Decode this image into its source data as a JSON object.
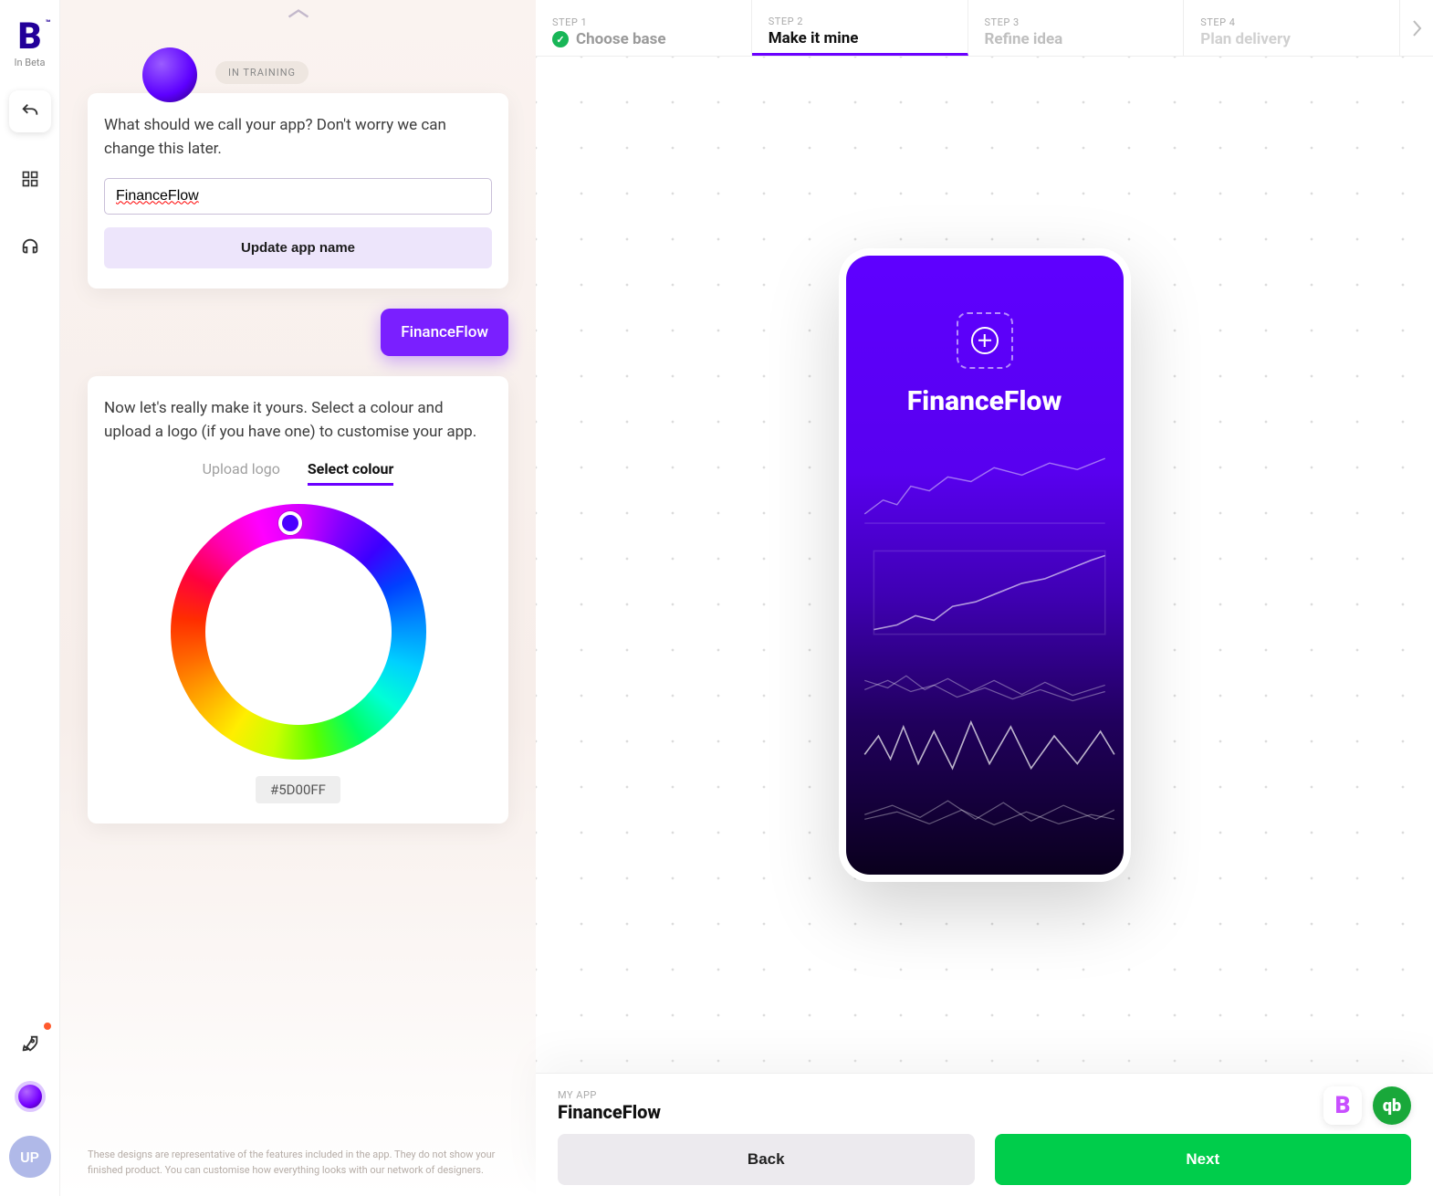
{
  "brand": {
    "mark": "B",
    "tm": "™",
    "sub": "In Beta"
  },
  "rail": {
    "avatar_initials": "UP"
  },
  "training_badge": "IN TRAINING",
  "name_card": {
    "prompt": "What should we call your app? Don't worry we can change this later.",
    "value": "FinanceFlow",
    "update_btn": "Update app name"
  },
  "user_reply": "FinanceFlow",
  "colour_card": {
    "prompt": "Now let's really make it yours. Select a colour and upload a logo (if you have one) to customise your app.",
    "tab_upload": "Upload logo",
    "tab_colour": "Select colour",
    "hex": "#5D00FF"
  },
  "note": "These designs are representative of the features included in the app. They do not show your finished product. You can customise how everything looks with our network of designers.",
  "steps": [
    {
      "step_label": "STEP 1",
      "title": "Choose base",
      "state": "done"
    },
    {
      "step_label": "STEP 2",
      "title": "Make it mine",
      "state": "active"
    },
    {
      "step_label": "STEP 3",
      "title": "Refine idea",
      "state": "pending"
    },
    {
      "step_label": "STEP 4",
      "title": "Plan delivery",
      "state": "future"
    }
  ],
  "phone": {
    "app_title": "FinanceFlow"
  },
  "footer": {
    "label": "MY APP",
    "title": "FinanceFlow",
    "back": "Back",
    "next": "Next"
  },
  "colors": {
    "accent": "#5D00FF",
    "next_btn": "#00CD4B"
  }
}
